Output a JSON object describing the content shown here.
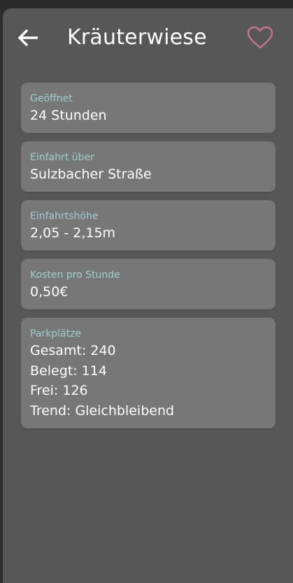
{
  "header": {
    "title": "Kräuterwiese",
    "back_icon": "arrow-left-icon",
    "favorite_icon": "heart-outline-icon",
    "favorite_color": "#c3768e"
  },
  "colors": {
    "sheet_background": "#575757",
    "card_background": "#777777",
    "label_color": "#9fd0cc",
    "value_color": "#ffffff"
  },
  "cards": {
    "opening": {
      "label": "Geöffnet",
      "value": "24 Stunden"
    },
    "entrance": {
      "label": "Einfahrt über",
      "value": "Sulzbacher Straße"
    },
    "height": {
      "label": "Einfahrtshöhe",
      "value": "2,05 - 2,15m"
    },
    "cost": {
      "label": "Kosten pro Stunde",
      "value": "0,50€"
    },
    "parking": {
      "label": "Parkplätze",
      "lines": [
        "Gesamt: 240",
        "Belegt: 114",
        "Frei: 126",
        "Trend: Gleichbleibend"
      ]
    }
  }
}
